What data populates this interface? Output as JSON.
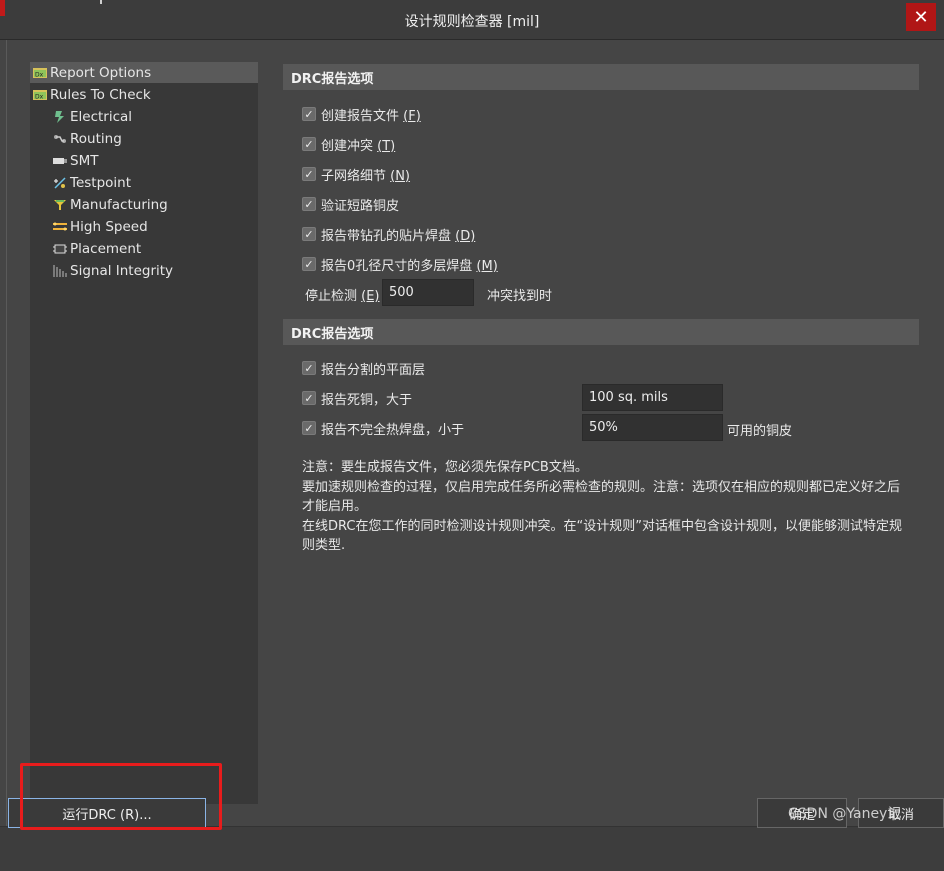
{
  "window": {
    "title": "设计规则检查器 [mil]",
    "close_glyph": "✕"
  },
  "tree": {
    "items": [
      {
        "label": "Report Options",
        "icon": "report-options-icon",
        "level": 0,
        "selected": true
      },
      {
        "label": "Rules To Check",
        "icon": "rules-to-check-icon",
        "level": 0,
        "selected": false
      },
      {
        "label": "Electrical",
        "icon": "electrical-icon",
        "level": 1
      },
      {
        "label": "Routing",
        "icon": "routing-icon",
        "level": 1
      },
      {
        "label": "SMT",
        "icon": "smt-icon",
        "level": 1
      },
      {
        "label": "Testpoint",
        "icon": "testpoint-icon",
        "level": 1
      },
      {
        "label": "Manufacturing",
        "icon": "manufacturing-icon",
        "level": 1
      },
      {
        "label": "High Speed",
        "icon": "high-speed-icon",
        "level": 1
      },
      {
        "label": "Placement",
        "icon": "placement-icon",
        "level": 1
      },
      {
        "label": "Signal Integrity",
        "icon": "signal-integrity-icon",
        "level": 1
      }
    ]
  },
  "section1": {
    "header": "DRC报告选项",
    "options": [
      {
        "label": "创建报告文件 ",
        "key": "(F)",
        "checked": true
      },
      {
        "label": "创建冲突 ",
        "key": "(T)",
        "checked": true
      },
      {
        "label": "子网络细节 ",
        "key": "(N)",
        "checked": true
      },
      {
        "label": "验证短路铜皮",
        "key": "",
        "checked": true
      },
      {
        "label": "报告带钻孔的贴片焊盘 ",
        "key": "(D)",
        "checked": true
      },
      {
        "label": "报告0孔径尺寸的多层焊盘 ",
        "key": "(M)",
        "checked": true
      }
    ],
    "stop_label": "停止检测 ",
    "stop_key": "(E)",
    "stop_value": "500",
    "stop_suffix": "冲突找到时"
  },
  "section2": {
    "header": "DRC报告选项",
    "options": [
      {
        "label": "报告分割的平面层",
        "checked": true
      },
      {
        "label": "报告死铜，大于",
        "checked": true,
        "value": "100 sq. mils"
      },
      {
        "label": "报告不完全热焊盘，小于",
        "checked": true,
        "value": "50%",
        "suffix": "可用的铜皮"
      }
    ]
  },
  "note": {
    "lines": [
      "注意：要生成报告文件，您必须先保存PCB文档。",
      "要加速规则检查的过程，仅启用完成任务所必需检查的规则。注意：选项仅在相应的规则都已定义好之后才能启用。",
      "在线DRC在您工作的同时检测设计规则冲突。在“设计规则”对话框中包含设计规则，以便能够测试特定规则类型."
    ]
  },
  "buttons": {
    "run": "运行DRC (R)...",
    "ok": "确定",
    "cancel": "取消"
  },
  "watermark": "CSDN @Yaney记",
  "check_glyph": "✓",
  "colors": {
    "highlight": "#e81c1c",
    "close": "#b01616"
  }
}
